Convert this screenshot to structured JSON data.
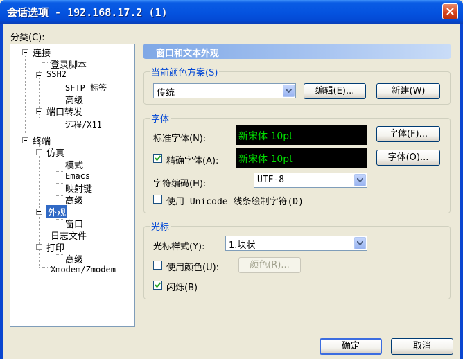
{
  "window": {
    "title": "会话选项 - 192.168.17.2 (1)"
  },
  "category": {
    "label": "分类(C):"
  },
  "tree": {
    "connection": "连接",
    "login_script": "登录脚本",
    "ssh2": "SSH2",
    "sftp_tab": "SFTP 标签",
    "ssh2_advanced": "高级",
    "port_forward": "端口转发",
    "remote_x11": "远程/X11",
    "terminal": "终端",
    "emulation": "仿真",
    "modes": "模式",
    "emacs": "Emacs",
    "mapped_keys": "映射键",
    "emulation_advanced": "高级",
    "appearance": "外观",
    "window": "窗口",
    "log_file": "日志文件",
    "print": "打印",
    "print_advanced": "高级",
    "xzmodem": "Xmodem/Zmodem"
  },
  "panel": {
    "header": "窗口和文本外观"
  },
  "color_scheme": {
    "legend": "当前颜色方案(S)",
    "value": "传统",
    "edit_label": "编辑(E)...",
    "new_label": "新建(W)"
  },
  "font": {
    "legend": "字体",
    "normal_label": "标准字体(N):",
    "normal_preview": "新宋体 10pt",
    "normal_button": "字体(F)...",
    "precise_label": "精确字体(A):",
    "precise_checked": true,
    "precise_preview": "新宋体 10pt",
    "precise_button": "字体(O)...",
    "encoding_label": "字符编码(H):",
    "encoding_value": "UTF-8",
    "unicode_label": "使用 Unicode 线条绘制字符(D)",
    "unicode_checked": false
  },
  "cursor": {
    "legend": "光标",
    "style_label": "光标样式(Y):",
    "style_value": "1.块状",
    "use_color_label": "使用颜色(U):",
    "use_color_checked": false,
    "color_button": "颜色(R)...",
    "blink_label": "闪烁(B)",
    "blink_checked": true
  },
  "footer": {
    "ok_label": "确定",
    "cancel_label": "取消"
  },
  "colors": {
    "accent": "#0a5ce4",
    "selection": "#316ac5",
    "legend_text": "#0046d5",
    "preview_text": "#00e000"
  }
}
